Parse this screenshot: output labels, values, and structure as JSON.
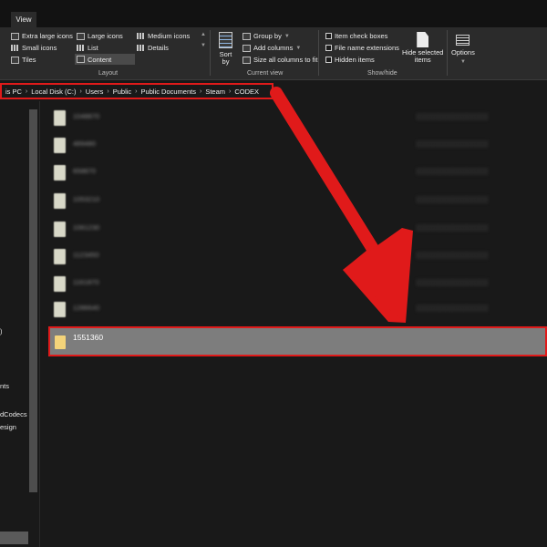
{
  "ribbon": {
    "tab": "View",
    "layout": {
      "label": "Layout",
      "items": [
        "Extra large icons",
        "Large icons",
        "Medium icons",
        "Small icons",
        "List",
        "Details",
        "Tiles",
        "Content"
      ]
    },
    "sort": {
      "label": "Sort",
      "sub": "by"
    },
    "current_view": {
      "label": "Current view",
      "group_by": "Group by",
      "add_columns": "Add columns",
      "size_all": "Size all columns to fit"
    },
    "show_hide": {
      "label": "Show/hide",
      "item_check_boxes": "Item check boxes",
      "file_name_extensions": "File name extensions",
      "hidden_items": "Hidden items",
      "hide_selected": "Hide selected",
      "hide_selected_2": "items"
    },
    "options": "Options"
  },
  "address": [
    "is PC",
    "Local Disk (C:)",
    "Users",
    "Public",
    "Public Documents",
    "Steam",
    "CODEX"
  ],
  "nav": {
    "items": [
      ")",
      "nts",
      "dCodecs",
      "esign"
    ]
  },
  "files": {
    "blurred": [
      "1048870",
      "489480",
      "658870",
      "1053210",
      "1061230",
      "1123450",
      "1161870",
      "1286640"
    ],
    "selected": "1551360"
  },
  "colors": {
    "highlight": "#e01a1a",
    "selected_row": "#7d7d7d",
    "folder": "#f3d37a"
  }
}
